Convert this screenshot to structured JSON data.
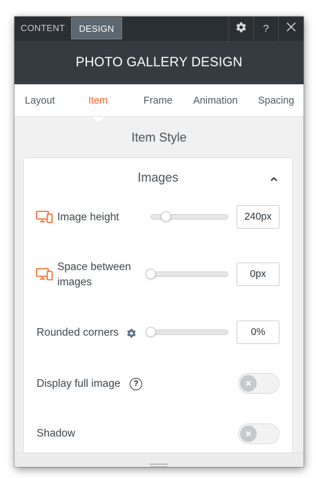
{
  "header": {
    "tabs": [
      "CONTENT",
      "DESIGN"
    ],
    "active_tab": "DESIGN",
    "buttons": [
      {
        "name": "settings",
        "icon": "gear-icon"
      },
      {
        "name": "help",
        "label": "?",
        "icon": "question-icon"
      },
      {
        "name": "close",
        "icon": "close-icon"
      }
    ]
  },
  "title": "PHOTO GALLERY DESIGN",
  "subtabs": {
    "items": [
      "Layout",
      "Item",
      "Frame",
      "Animation",
      "Spacing"
    ],
    "active": "Item"
  },
  "section": {
    "title": "Item Style"
  },
  "panel": {
    "title": "Images",
    "collapse_icon": "chevron-up-icon",
    "rows": [
      {
        "label": "Image height",
        "icon": "desktop-mobile-icon",
        "value": "240px",
        "slider_fraction": 0.2
      },
      {
        "label": "Space between images",
        "line1": "Space between",
        "line2": "images",
        "icon": "desktop-mobile-icon",
        "value": "0px",
        "slider_fraction": 0.0
      },
      {
        "label": "Rounded corners",
        "icon": "gear-icon",
        "value": "0%",
        "slider_fraction": 0.0
      },
      {
        "label": "Display full image",
        "icon": "question-circle-icon",
        "toggle": "off"
      },
      {
        "label": "Shadow",
        "toggle": "off"
      }
    ]
  },
  "colors": {
    "accent": "#f0662a",
    "topbar": "#2a2f34",
    "titlebar": "#353b40",
    "active_tab": "#5a6670"
  }
}
